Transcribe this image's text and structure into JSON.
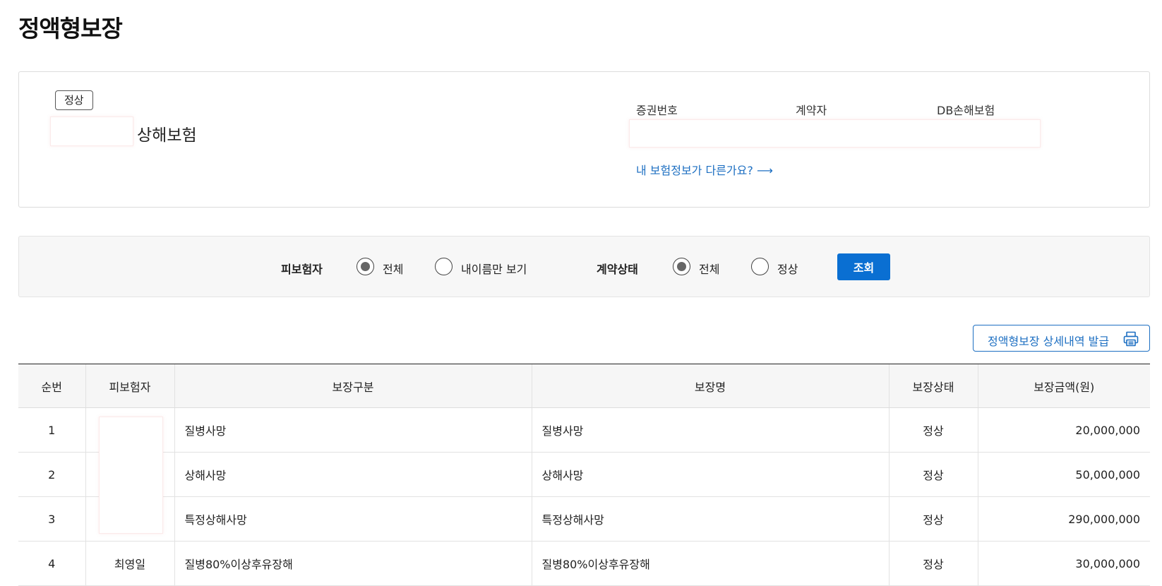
{
  "page": {
    "title": "정액형보장"
  },
  "policy": {
    "status_badge": "정상",
    "product_name": "상해보험",
    "labels": {
      "certificate_no": "증권번호",
      "contractor": "계약자",
      "insurer": "DB손해보험"
    },
    "info_link": "내 보험정보가 다른가요? ⟶"
  },
  "filter": {
    "insured_label": "피보험자",
    "insured_options": [
      {
        "label": "전체",
        "checked": true
      },
      {
        "label": "내이름만 보기",
        "checked": false
      }
    ],
    "contract_status_label": "계약상태",
    "contract_status_options": [
      {
        "label": "전체",
        "checked": true
      },
      {
        "label": "정상",
        "checked": false
      }
    ],
    "search_button": "조회"
  },
  "actions": {
    "issue_button": "정액형보장 상세내역 발급",
    "issue_icon": "printer-icon"
  },
  "table": {
    "headers": [
      "순번",
      "피보험자",
      "보장구분",
      "보장명",
      "보장상태",
      "보장금액(원)"
    ],
    "rows": [
      {
        "no": "1",
        "insured": "",
        "category": "질병사망",
        "name": "질병사망",
        "status": "정상",
        "amount": "20,000,000"
      },
      {
        "no": "2",
        "insured": "",
        "category": "상해사망",
        "name": "상해사망",
        "status": "정상",
        "amount": "50,000,000"
      },
      {
        "no": "3",
        "insured": "",
        "category": "특정상해사망",
        "name": "특정상해사망",
        "status": "정상",
        "amount": "290,000,000"
      },
      {
        "no": "4",
        "insured": "최영일",
        "category": "질병80%이상후유장해",
        "name": "질병80%이상후유장해",
        "status": "정상",
        "amount": "30,000,000"
      }
    ]
  },
  "colors": {
    "accent": "#0a6fd2",
    "link": "#1d6fc2",
    "panel_bg": "#f7f7f7",
    "border": "#dcdcdc"
  }
}
